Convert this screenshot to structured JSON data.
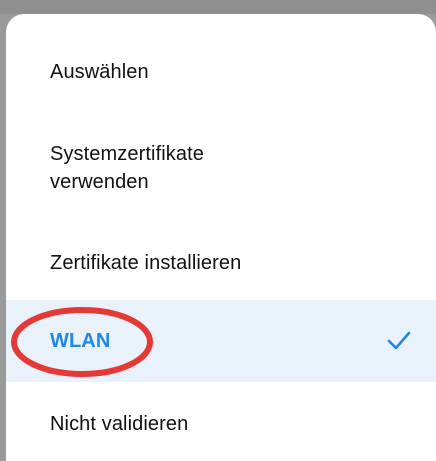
{
  "menu": {
    "items": [
      {
        "label": "Auswählen"
      },
      {
        "label": "Systemzertifikate\nverwenden"
      },
      {
        "label": "Zertifikate installieren"
      },
      {
        "label": "WLAN",
        "selected": true
      },
      {
        "label": "Nicht validieren"
      }
    ]
  },
  "icons": {
    "selected_indicator": "checkmark-icon"
  },
  "colors": {
    "selected_text": "#1e88e5",
    "selected_background": "#e9f1fb",
    "annotation": "#e53935",
    "text": "#111111"
  }
}
